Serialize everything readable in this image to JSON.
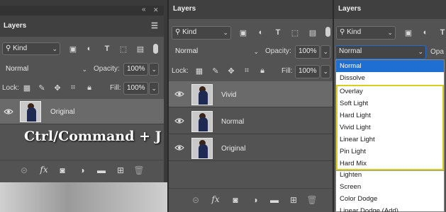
{
  "panel1": {
    "title": "Layers",
    "collapse_glyph": "«",
    "close_glyph": "✕",
    "kind_value": "Kind",
    "blend_value": "Normal",
    "opacity_label": "Opacity:",
    "opacity_value": "100%",
    "lock_label": "Lock:",
    "fill_label": "Fill:",
    "fill_value": "100%",
    "layers": [
      {
        "name": "Original"
      }
    ],
    "overlay_text": "Ctrl/Command + J"
  },
  "panel2": {
    "title": "Layers",
    "kind_value": "Kind",
    "blend_value": "Normal",
    "opacity_label": "Opacity:",
    "opacity_value": "100%",
    "lock_label": "Lock:",
    "fill_label": "Fill:",
    "fill_value": "100%",
    "layers": [
      {
        "name": "Vivid"
      },
      {
        "name": "Normal"
      },
      {
        "name": "Original"
      }
    ]
  },
  "panel3": {
    "title": "Layers",
    "kind_value": "Kind",
    "blend_value": "Normal",
    "opacity_label_partial": "Opa"
  },
  "blend_menu": {
    "items": [
      "Normal",
      "Dissolve",
      "Overlay",
      "Soft Light",
      "Hard Light",
      "Vivid Light",
      "Linear Light",
      "Pin Light",
      "Hard Mix",
      "Lighten",
      "Screen",
      "Color Dodge",
      "Linear Dodge (Add)"
    ],
    "highlighted": "Normal",
    "group_border_color": "#d6cf1e",
    "highlight_color": "#1f6fd2"
  },
  "footer_icons": [
    "link-icon",
    "fx-icon",
    "mask-icon",
    "adjustment-icon",
    "folder-icon",
    "new-layer-icon",
    "trash-icon"
  ]
}
